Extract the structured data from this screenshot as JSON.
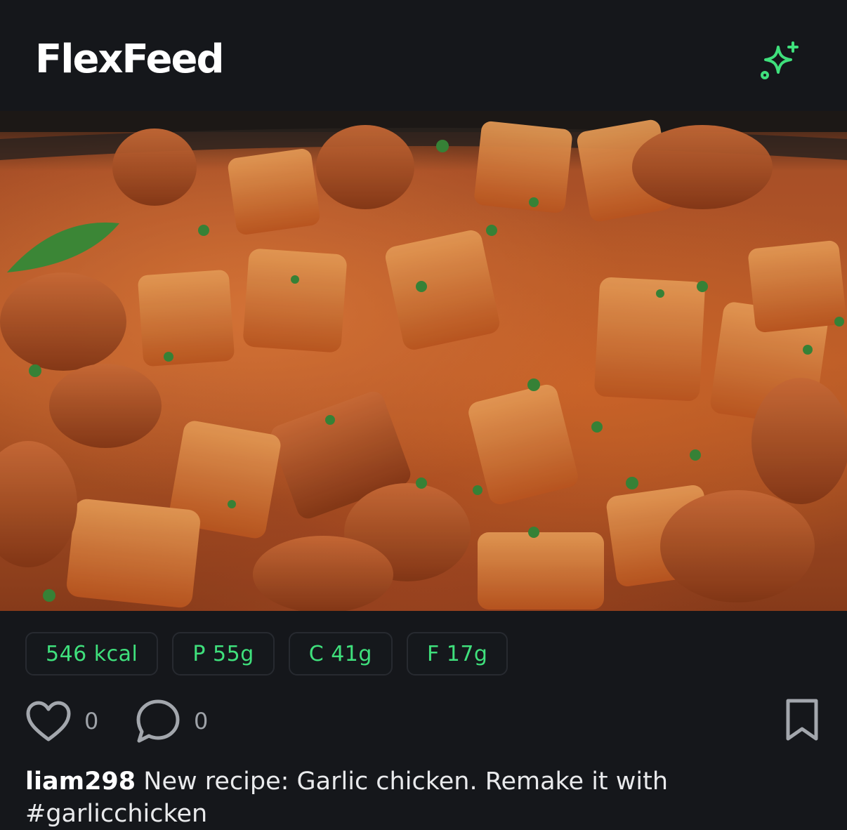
{
  "header": {
    "title": "FlexFeed",
    "ai_icon": "sparkle-plus-icon",
    "accent": "#3fe07c"
  },
  "post": {
    "image_alt": "Garlic chicken with roasted potatoes",
    "macros": {
      "kcal": "546 kcal",
      "protein": "P 55g",
      "carbs": "C 41g",
      "fat": "F 17g"
    },
    "actions": {
      "likes": "0",
      "comments": "0"
    },
    "caption": {
      "username": "liam298",
      "text": " New recipe: Garlic chicken. Remake it with #garlicchicken"
    }
  }
}
